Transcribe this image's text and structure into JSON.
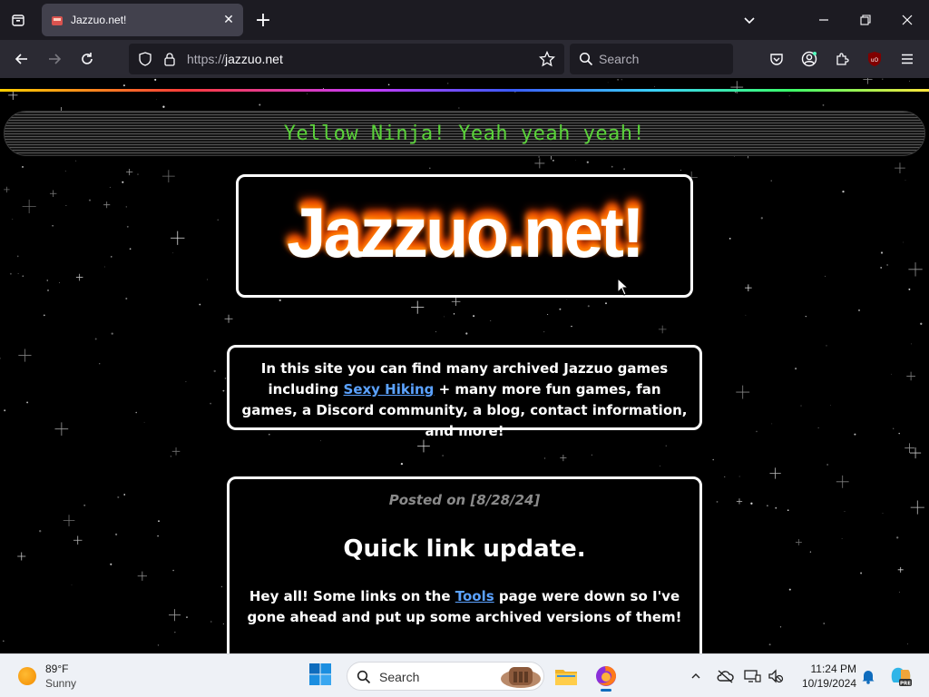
{
  "browser": {
    "tab_title": "Jazzuo.net!",
    "url_protocol": "https://",
    "url_host": "jazzuo.net",
    "search_placeholder": "Search",
    "accent_color": "#42414d"
  },
  "page": {
    "marquee_text": "Yellow Ninja! Yeah yeah yeah!",
    "logo_text": "Jazzuo.net!",
    "intro": {
      "before_link": "In this site you can find many archived Jazzuo games including",
      "link_text": "Sexy Hiking",
      "after_link": "+ many more fun games, fan games, a Discord community, a blog, contact information, and more!"
    },
    "post": {
      "date": "Posted on [8/28/24]",
      "title": "Quick link update.",
      "body_before_link": "Hey all! Some links on the",
      "link_text": "Tools",
      "body_after_link": "page were down so I've gone ahead and put up some archived versions of them!"
    },
    "colors": {
      "marquee_text": "#5bd33b",
      "link": "#5ba2ff",
      "background": "#000000",
      "border": "#ffffff"
    }
  },
  "taskbar": {
    "weather_temp": "89°F",
    "weather_condition": "Sunny",
    "search_label": "Search",
    "time": "11:24 PM",
    "date": "10/19/2024"
  }
}
